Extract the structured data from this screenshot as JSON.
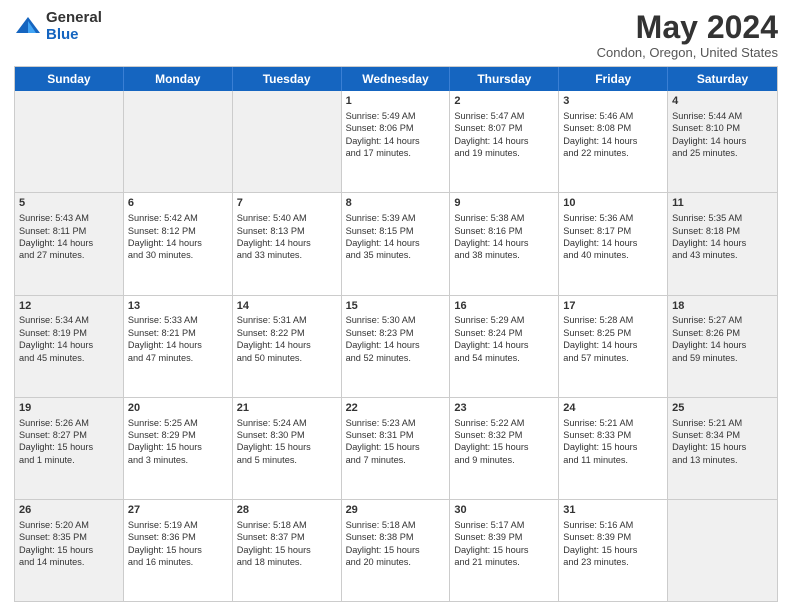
{
  "logo": {
    "general": "General",
    "blue": "Blue"
  },
  "title": "May 2024",
  "subtitle": "Condon, Oregon, United States",
  "days": [
    "Sunday",
    "Monday",
    "Tuesday",
    "Wednesday",
    "Thursday",
    "Friday",
    "Saturday"
  ],
  "weeks": [
    [
      {
        "day": "",
        "text": "",
        "shaded": true
      },
      {
        "day": "",
        "text": "",
        "shaded": true
      },
      {
        "day": "",
        "text": "",
        "shaded": true
      },
      {
        "day": "1",
        "text": "Sunrise: 5:49 AM\nSunset: 8:06 PM\nDaylight: 14 hours\nand 17 minutes.",
        "shaded": false
      },
      {
        "day": "2",
        "text": "Sunrise: 5:47 AM\nSunset: 8:07 PM\nDaylight: 14 hours\nand 19 minutes.",
        "shaded": false
      },
      {
        "day": "3",
        "text": "Sunrise: 5:46 AM\nSunset: 8:08 PM\nDaylight: 14 hours\nand 22 minutes.",
        "shaded": false
      },
      {
        "day": "4",
        "text": "Sunrise: 5:44 AM\nSunset: 8:10 PM\nDaylight: 14 hours\nand 25 minutes.",
        "shaded": true
      }
    ],
    [
      {
        "day": "5",
        "text": "Sunrise: 5:43 AM\nSunset: 8:11 PM\nDaylight: 14 hours\nand 27 minutes.",
        "shaded": true
      },
      {
        "day": "6",
        "text": "Sunrise: 5:42 AM\nSunset: 8:12 PM\nDaylight: 14 hours\nand 30 minutes.",
        "shaded": false
      },
      {
        "day": "7",
        "text": "Sunrise: 5:40 AM\nSunset: 8:13 PM\nDaylight: 14 hours\nand 33 minutes.",
        "shaded": false
      },
      {
        "day": "8",
        "text": "Sunrise: 5:39 AM\nSunset: 8:15 PM\nDaylight: 14 hours\nand 35 minutes.",
        "shaded": false
      },
      {
        "day": "9",
        "text": "Sunrise: 5:38 AM\nSunset: 8:16 PM\nDaylight: 14 hours\nand 38 minutes.",
        "shaded": false
      },
      {
        "day": "10",
        "text": "Sunrise: 5:36 AM\nSunset: 8:17 PM\nDaylight: 14 hours\nand 40 minutes.",
        "shaded": false
      },
      {
        "day": "11",
        "text": "Sunrise: 5:35 AM\nSunset: 8:18 PM\nDaylight: 14 hours\nand 43 minutes.",
        "shaded": true
      }
    ],
    [
      {
        "day": "12",
        "text": "Sunrise: 5:34 AM\nSunset: 8:19 PM\nDaylight: 14 hours\nand 45 minutes.",
        "shaded": true
      },
      {
        "day": "13",
        "text": "Sunrise: 5:33 AM\nSunset: 8:21 PM\nDaylight: 14 hours\nand 47 minutes.",
        "shaded": false
      },
      {
        "day": "14",
        "text": "Sunrise: 5:31 AM\nSunset: 8:22 PM\nDaylight: 14 hours\nand 50 minutes.",
        "shaded": false
      },
      {
        "day": "15",
        "text": "Sunrise: 5:30 AM\nSunset: 8:23 PM\nDaylight: 14 hours\nand 52 minutes.",
        "shaded": false
      },
      {
        "day": "16",
        "text": "Sunrise: 5:29 AM\nSunset: 8:24 PM\nDaylight: 14 hours\nand 54 minutes.",
        "shaded": false
      },
      {
        "day": "17",
        "text": "Sunrise: 5:28 AM\nSunset: 8:25 PM\nDaylight: 14 hours\nand 57 minutes.",
        "shaded": false
      },
      {
        "day": "18",
        "text": "Sunrise: 5:27 AM\nSunset: 8:26 PM\nDaylight: 14 hours\nand 59 minutes.",
        "shaded": true
      }
    ],
    [
      {
        "day": "19",
        "text": "Sunrise: 5:26 AM\nSunset: 8:27 PM\nDaylight: 15 hours\nand 1 minute.",
        "shaded": true
      },
      {
        "day": "20",
        "text": "Sunrise: 5:25 AM\nSunset: 8:29 PM\nDaylight: 15 hours\nand 3 minutes.",
        "shaded": false
      },
      {
        "day": "21",
        "text": "Sunrise: 5:24 AM\nSunset: 8:30 PM\nDaylight: 15 hours\nand 5 minutes.",
        "shaded": false
      },
      {
        "day": "22",
        "text": "Sunrise: 5:23 AM\nSunset: 8:31 PM\nDaylight: 15 hours\nand 7 minutes.",
        "shaded": false
      },
      {
        "day": "23",
        "text": "Sunrise: 5:22 AM\nSunset: 8:32 PM\nDaylight: 15 hours\nand 9 minutes.",
        "shaded": false
      },
      {
        "day": "24",
        "text": "Sunrise: 5:21 AM\nSunset: 8:33 PM\nDaylight: 15 hours\nand 11 minutes.",
        "shaded": false
      },
      {
        "day": "25",
        "text": "Sunrise: 5:21 AM\nSunset: 8:34 PM\nDaylight: 15 hours\nand 13 minutes.",
        "shaded": true
      }
    ],
    [
      {
        "day": "26",
        "text": "Sunrise: 5:20 AM\nSunset: 8:35 PM\nDaylight: 15 hours\nand 14 minutes.",
        "shaded": true
      },
      {
        "day": "27",
        "text": "Sunrise: 5:19 AM\nSunset: 8:36 PM\nDaylight: 15 hours\nand 16 minutes.",
        "shaded": false
      },
      {
        "day": "28",
        "text": "Sunrise: 5:18 AM\nSunset: 8:37 PM\nDaylight: 15 hours\nand 18 minutes.",
        "shaded": false
      },
      {
        "day": "29",
        "text": "Sunrise: 5:18 AM\nSunset: 8:38 PM\nDaylight: 15 hours\nand 20 minutes.",
        "shaded": false
      },
      {
        "day": "30",
        "text": "Sunrise: 5:17 AM\nSunset: 8:39 PM\nDaylight: 15 hours\nand 21 minutes.",
        "shaded": false
      },
      {
        "day": "31",
        "text": "Sunrise: 5:16 AM\nSunset: 8:39 PM\nDaylight: 15 hours\nand 23 minutes.",
        "shaded": false
      },
      {
        "day": "",
        "text": "",
        "shaded": true
      }
    ]
  ]
}
